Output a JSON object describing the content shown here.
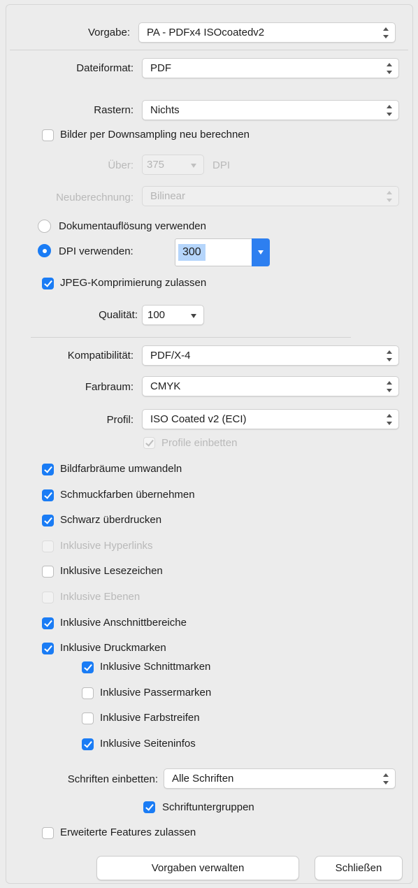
{
  "vorgabe": {
    "label": "Vorgabe:",
    "value": "PA - PDFx4 ISOcoatedv2"
  },
  "dateiformat": {
    "label": "Dateiformat:",
    "value": "PDF"
  },
  "rastern": {
    "label": "Rastern:",
    "value": "Nichts"
  },
  "downsampling": {
    "label": "Bilder per Downsampling neu berechnen",
    "checked": false
  },
  "ueber": {
    "label": "Über:",
    "value": "375",
    "unit": "DPI"
  },
  "neuberechnung": {
    "label": "Neuberechnung:",
    "value": "Bilinear"
  },
  "resolution": {
    "doc_label": "Dokumentauflösung verwenden",
    "dpi_label": "DPI verwenden:",
    "dpi_value": "300",
    "selected": "dpi"
  },
  "jpeg": {
    "label": "JPEG-Komprimierung zulassen",
    "checked": true
  },
  "qualitaet": {
    "label": "Qualität:",
    "value": "100"
  },
  "kompatibilitaet": {
    "label": "Kompatibilität:",
    "value": "PDF/X-4"
  },
  "farbraum": {
    "label": "Farbraum:",
    "value": "CMYK"
  },
  "profil": {
    "label": "Profil:",
    "value": "ISO Coated v2 (ECI)"
  },
  "profile_einbetten": {
    "label": "Profile einbetten",
    "checked": true,
    "enabled": false
  },
  "options": [
    {
      "label": "Bildfarbräume umwandeln",
      "checked": true,
      "enabled": true
    },
    {
      "label": "Schmuckfarben übernehmen",
      "checked": true,
      "enabled": true
    },
    {
      "label": "Schwarz überdrucken",
      "checked": true,
      "enabled": true
    },
    {
      "label": "Inklusive Hyperlinks",
      "checked": false,
      "enabled": false
    },
    {
      "label": "Inklusive Lesezeichen",
      "checked": false,
      "enabled": true
    },
    {
      "label": "Inklusive Ebenen",
      "checked": false,
      "enabled": false
    },
    {
      "label": "Inklusive Anschnittbereiche",
      "checked": true,
      "enabled": true
    },
    {
      "label": "Inklusive Druckmarken",
      "checked": true,
      "enabled": true
    }
  ],
  "marks": [
    {
      "label": "Inklusive Schnittmarken",
      "checked": true
    },
    {
      "label": "Inklusive Passermarken",
      "checked": false
    },
    {
      "label": "Inklusive Farbstreifen",
      "checked": false
    },
    {
      "label": "Inklusive Seiteninfos",
      "checked": true
    }
  ],
  "schriften": {
    "label": "Schriften einbetten:",
    "value": "Alle Schriften"
  },
  "schriftuntergruppen": {
    "label": "Schriftuntergruppen",
    "checked": true
  },
  "erweitert": {
    "label": "Erweiterte Features zulassen",
    "checked": false
  },
  "buttons": {
    "manage": "Vorgaben verwalten",
    "close": "Schließen"
  },
  "colors": {
    "accent": "#1a7cf5",
    "selection": "#b5d5fb"
  },
  "icons": {
    "stepper": "up-down-chevron-icon",
    "dropdown": "chevron-down-icon",
    "check": "checkmark-icon"
  }
}
